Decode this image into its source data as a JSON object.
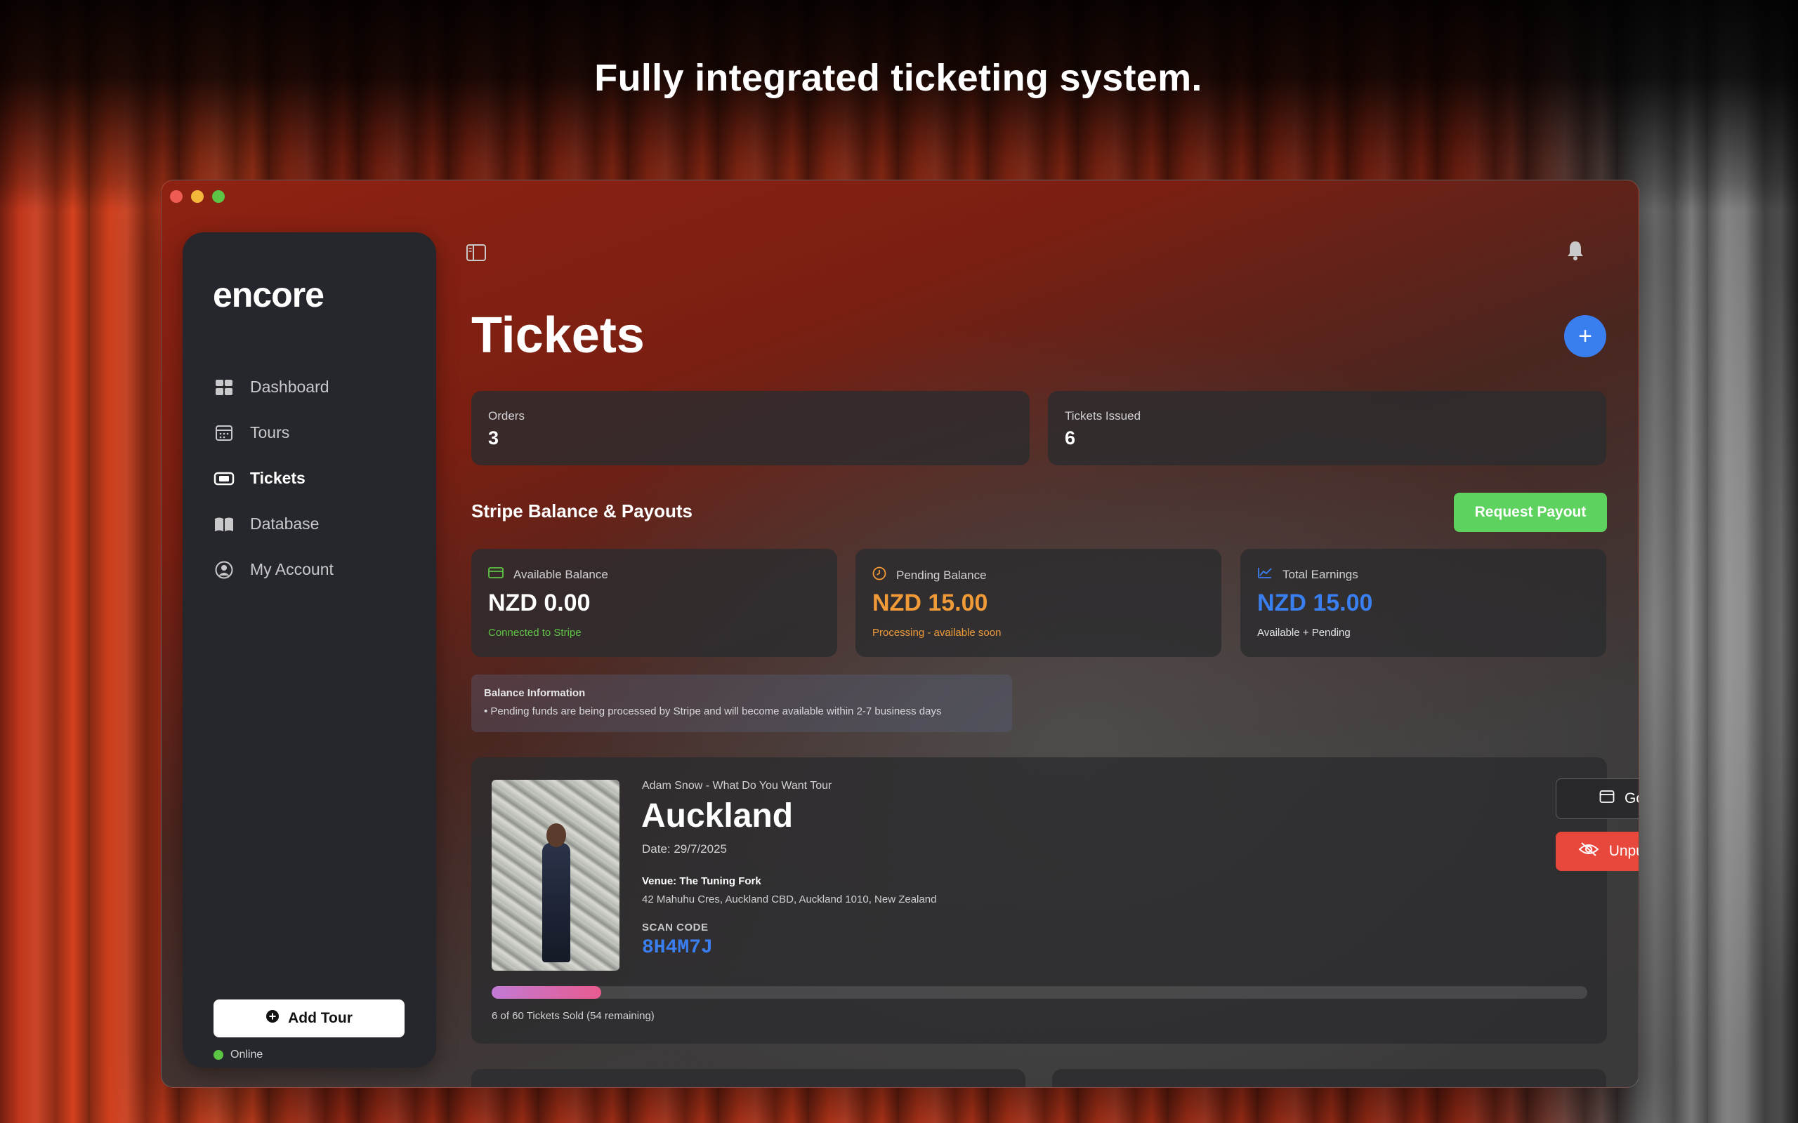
{
  "headline": "Fully integrated ticketing system.",
  "app": {
    "logo": "encore",
    "sidebar": {
      "items": [
        {
          "label": "Dashboard",
          "icon": "grid-icon",
          "active": false
        },
        {
          "label": "Tours",
          "icon": "calendar-icon",
          "active": false
        },
        {
          "label": "Tickets",
          "icon": "ticket-icon",
          "active": true
        },
        {
          "label": "Database",
          "icon": "book-icon",
          "active": false
        },
        {
          "label": "My Account",
          "icon": "user-circle-icon",
          "active": false
        }
      ],
      "add_tour_label": "Add Tour",
      "status": "Online"
    },
    "page_title": "Tickets",
    "stats": [
      {
        "label": "Orders",
        "value": "3"
      },
      {
        "label": "Tickets Issued",
        "value": "6"
      }
    ],
    "balance_section": {
      "title": "Stripe Balance & Payouts",
      "payout_label": "Request Payout",
      "cards": [
        {
          "label": "Available Balance",
          "value": "NZD 0.00",
          "sub": "Connected to Stripe",
          "icon": "credit-card-icon",
          "value_color": "#ffffff",
          "sub_color": "#5dc544"
        },
        {
          "label": "Pending Balance",
          "value": "NZD 15.00",
          "sub": "Processing - available soon",
          "icon": "clock-icon",
          "value_color": "#f19a38",
          "sub_color": "#f19a38"
        },
        {
          "label": "Total Earnings",
          "value": "NZD 15.00",
          "sub": "Available + Pending",
          "icon": "trend-chart-icon",
          "value_color": "#3a7ff0",
          "sub_color": "#e4e4e6"
        }
      ],
      "info_title": "Balance Information",
      "info_text": "• Pending funds are being processed by Stripe and will become available within 2-7 business days"
    },
    "show": {
      "tour_name": "Adam Snow - What Do You Want Tour",
      "city": "Auckland",
      "date": "Date: 29/7/2025",
      "venue": "Venue: The Tuning Fork",
      "address": "42 Mahuhu Cres, Auckland CBD, Auckland 1010, New Zealand",
      "scan_label": "SCAN CODE",
      "scan_code": "8H4M7J",
      "go_label": "Go To Show",
      "unpublish_label": "Unpublish Tickets",
      "sold": 6,
      "capacity": 60,
      "progress_text": "6 of 60 Tickets Sold (54 remaining)"
    },
    "colors": {
      "accent": "#3a7ff0",
      "success": "#5ed25f",
      "danger": "#e8473b"
    }
  }
}
